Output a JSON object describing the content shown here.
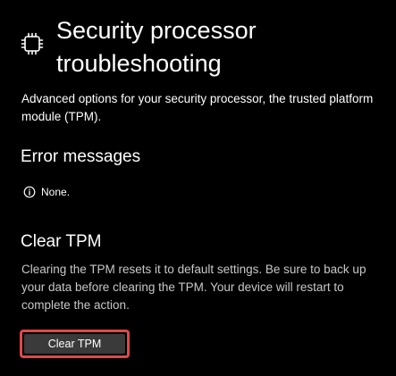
{
  "header": {
    "icon": "chip-icon",
    "title": "Security processor troubleshooting"
  },
  "intro": {
    "description": "Advanced options for your security processor, the trusted platform module (TPM)."
  },
  "error_messages": {
    "heading": "Error messages",
    "icon": "info-icon",
    "text": "None."
  },
  "clear_tpm": {
    "heading": "Clear TPM",
    "description": "Clearing the TPM resets it to default settings. Be sure to back up your data before clearing the TPM. Your device will restart to complete the action.",
    "button_label": "Clear TPM",
    "highlight_color": "#e0484a"
  },
  "colors": {
    "background": "#000000",
    "text": "#ffffff",
    "button_bg": "#3a3a3a"
  }
}
